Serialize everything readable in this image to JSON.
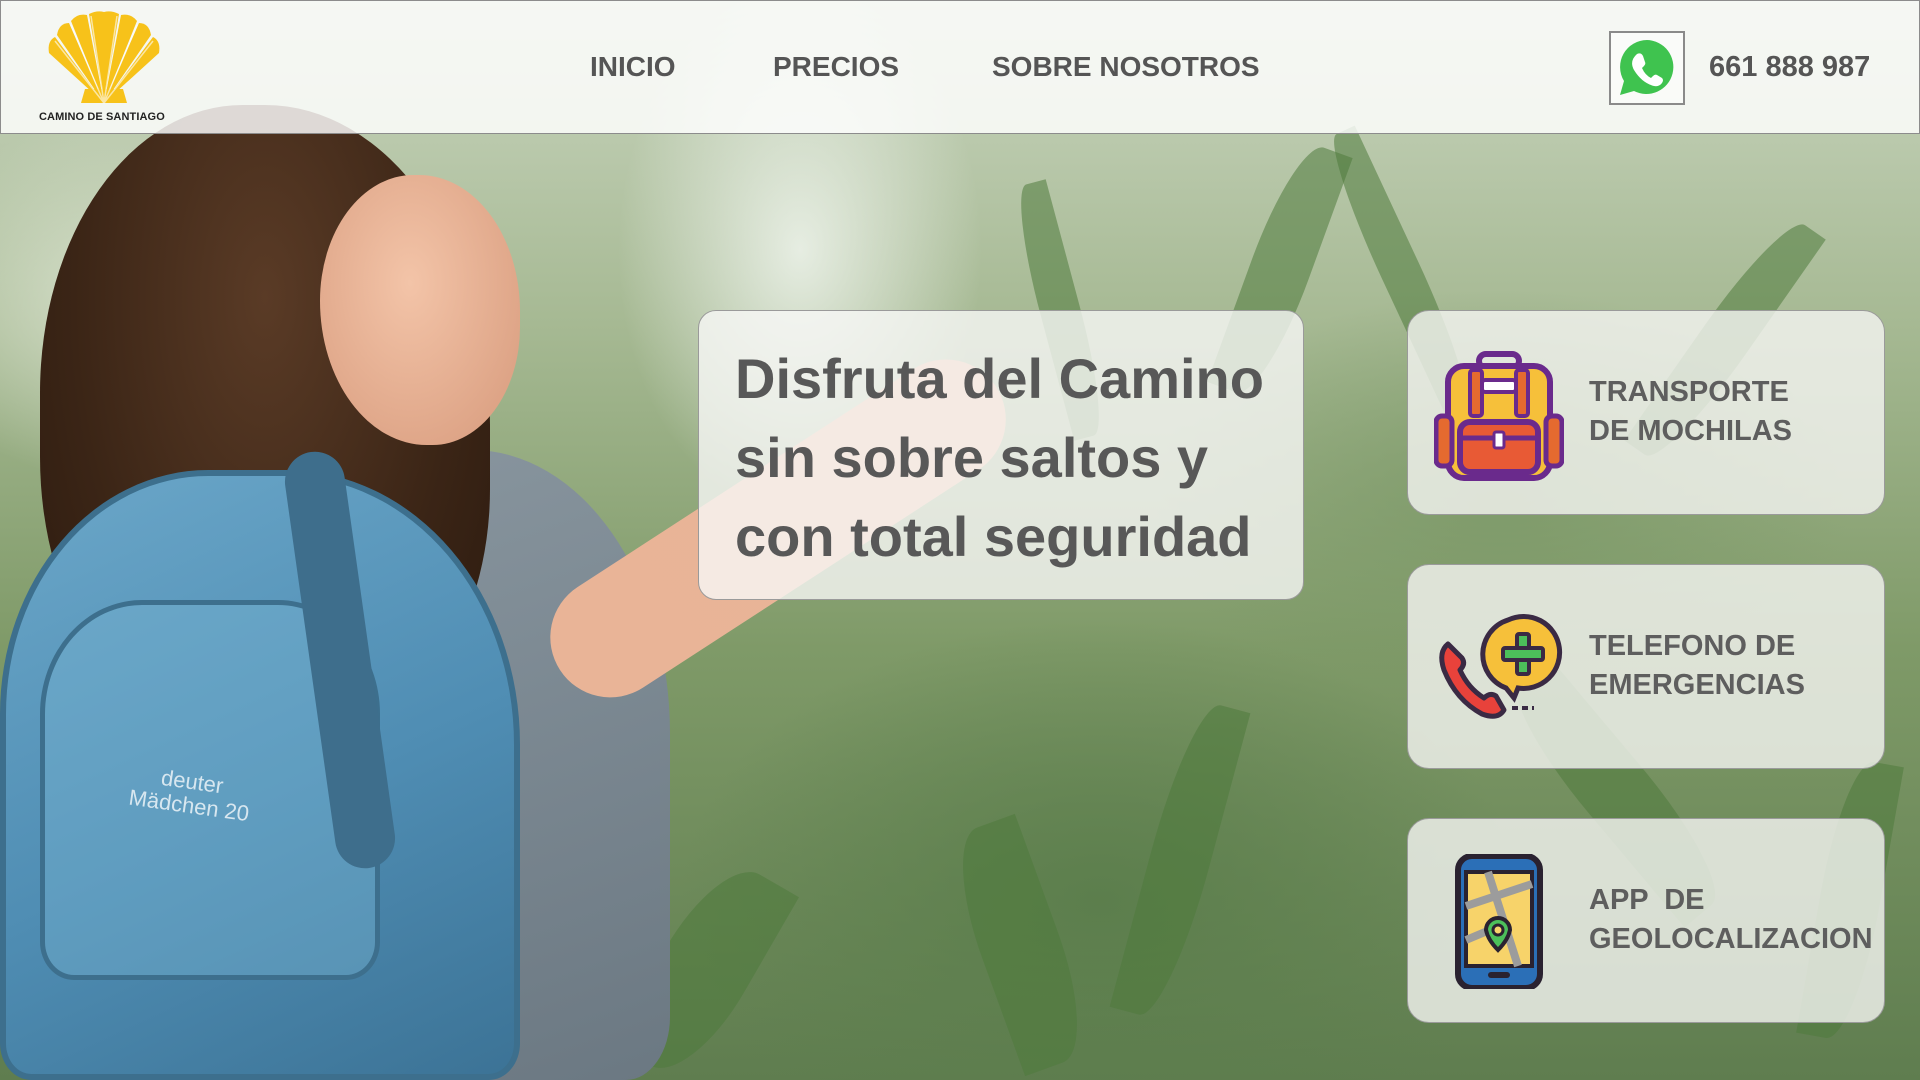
{
  "brand": {
    "name": "CAMINO DE SANTIAGO",
    "accent": "#f7c21a"
  },
  "nav": {
    "items": [
      {
        "label": "INICIO"
      },
      {
        "label": "PRECIOS"
      },
      {
        "label": "SOBRE NOSOTROS"
      }
    ]
  },
  "contact": {
    "whatsapp_icon": "whatsapp-icon",
    "whatsapp_color": "#3fc34f",
    "phone": "661 888 987"
  },
  "hero": {
    "lines": [
      "Disfruta del Camino",
      "sin sobre saltos y",
      "con total seguridad"
    ]
  },
  "background": {
    "backpack_brand": "deuter",
    "backpack_model": "Mädchen 20"
  },
  "features": [
    {
      "line1": "TRANSPORTE",
      "line2": "DE MOCHILAS",
      "icon": "backpack-icon"
    },
    {
      "line1": "TELEFONO DE",
      "line2": "EMERGENCIAS",
      "icon": "emergency-phone-icon"
    },
    {
      "line1": "APP  DE",
      "line2": "GEOLOCALIZACION",
      "icon": "map-phone-icon"
    }
  ]
}
